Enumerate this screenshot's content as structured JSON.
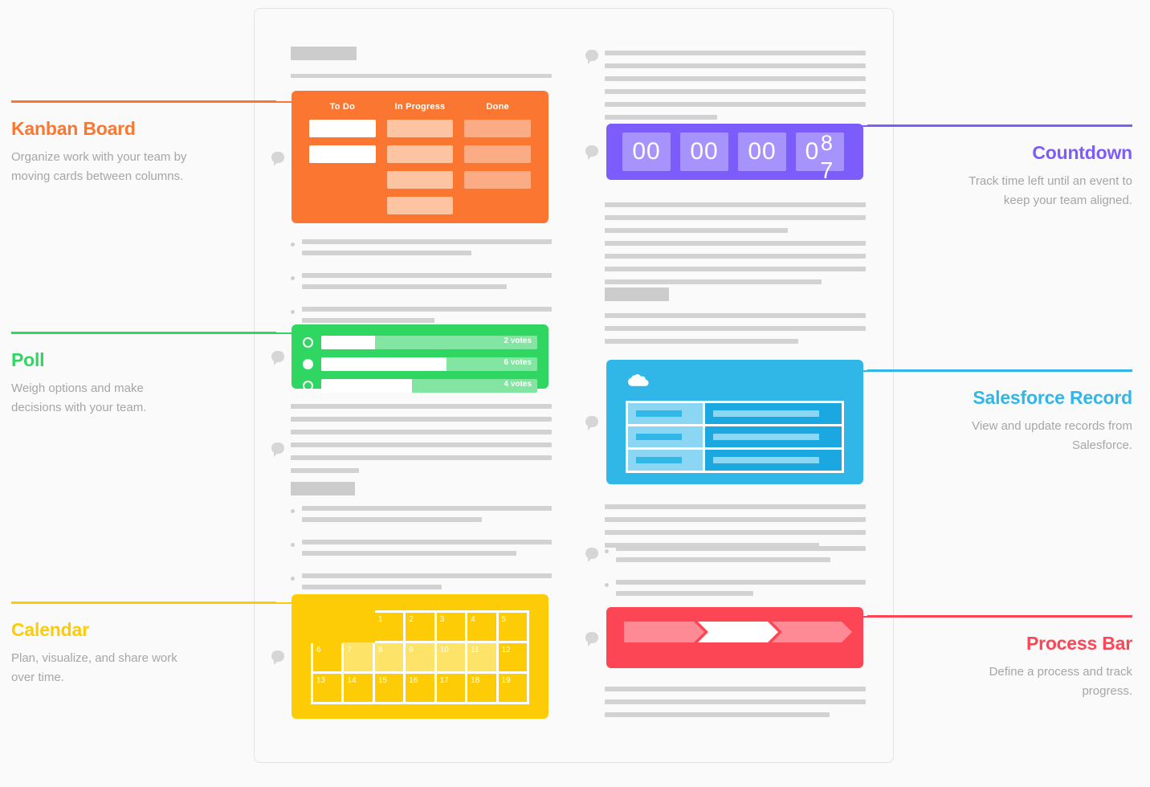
{
  "colors": {
    "kanban": "#fb7731",
    "countdown": "#7c5cfa",
    "poll": "#2fd661",
    "salesforce": "#31b6e8",
    "calendar": "#fdcc07",
    "processbar": "#fd4655",
    "muted_text": "#a6a6a6",
    "skeleton": "#d2d2d2",
    "page_bg": "#fafafa"
  },
  "callouts": {
    "kanban": {
      "title": "Kanban Board",
      "desc": "Organize work with your team by moving cards between columns."
    },
    "poll": {
      "title": "Poll",
      "desc": "Weigh options and make decisions with your team."
    },
    "calendar": {
      "title": "Calendar",
      "desc": "Plan, visualize, and share work over time."
    },
    "countdown": {
      "title": "Countdown",
      "desc": "Track time left until an event to keep your team aligned."
    },
    "salesforce": {
      "title": "Salesforce Record",
      "desc": "View and update records from Salesforce."
    },
    "processbar": {
      "title": "Process Bar",
      "desc": "Define a process and track progress."
    }
  },
  "widgets": {
    "kanban": {
      "columns": [
        {
          "header": "To Do",
          "cards": [
            "white",
            "white"
          ]
        },
        {
          "header": "In Progress",
          "cards": [
            "l1",
            "l1",
            "l1",
            "l1"
          ]
        },
        {
          "header": "Done",
          "cards": [
            "l2",
            "l2",
            "l2"
          ]
        }
      ]
    },
    "countdown": {
      "digits": [
        "00",
        "00",
        "00",
        "0"
      ],
      "flipping_digit": {
        "outgoing": "8",
        "incoming": "7"
      }
    },
    "poll": {
      "options": [
        {
          "votes_label": "2 votes",
          "fill_percent": 25,
          "selected": false
        },
        {
          "votes_label": "6 votes",
          "fill_percent": 58,
          "selected": true
        },
        {
          "votes_label": "4 votes",
          "fill_percent": 42,
          "selected": false
        }
      ]
    },
    "salesforce": {
      "icon": "salesforce-cloud-icon",
      "rows": [
        {
          "label_width": 62,
          "value_width": 92
        },
        {
          "label_width": 62,
          "value_width": 92
        },
        {
          "label_width": 62,
          "value_width": 92
        }
      ]
    },
    "calendar": {
      "weeks": [
        [
          {
            "type": "empty"
          },
          {
            "type": "empty"
          },
          {
            "type": "day",
            "n": "1"
          },
          {
            "type": "day",
            "n": "2"
          },
          {
            "type": "day",
            "n": "3"
          },
          {
            "type": "day",
            "n": "4"
          },
          {
            "type": "day",
            "n": "5"
          }
        ],
        [
          {
            "type": "day",
            "n": "6"
          },
          {
            "type": "day",
            "n": "7",
            "hl": true
          },
          {
            "type": "day",
            "n": "8",
            "hl": true
          },
          {
            "type": "day",
            "n": "9",
            "hl": true
          },
          {
            "type": "day",
            "n": "10",
            "hl": true
          },
          {
            "type": "day",
            "n": "11",
            "hl": true
          },
          {
            "type": "day",
            "n": "12"
          }
        ],
        [
          {
            "type": "day",
            "n": "13"
          },
          {
            "type": "day",
            "n": "14"
          },
          {
            "type": "day",
            "n": "15"
          },
          {
            "type": "day",
            "n": "16"
          },
          {
            "type": "day",
            "n": "17"
          },
          {
            "type": "day",
            "n": "18"
          },
          {
            "type": "day",
            "n": "19"
          }
        ]
      ]
    },
    "processbar": {
      "segments": [
        {
          "state": "dim"
        },
        {
          "state": "active"
        },
        {
          "state": "dim"
        }
      ]
    }
  }
}
